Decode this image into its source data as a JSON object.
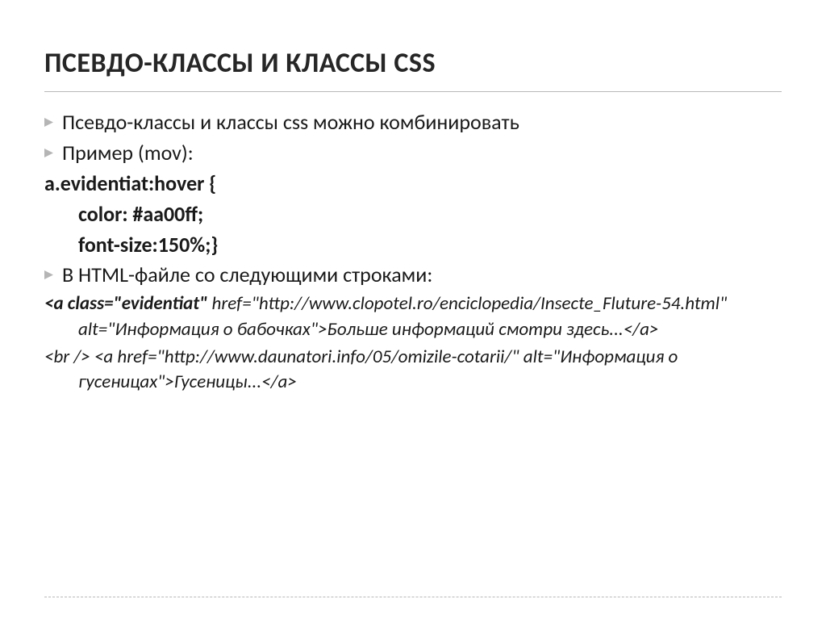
{
  "title": "ПСЕВДО-КЛАССЫ И КЛАССЫ CSS",
  "bullets": {
    "b1": "Псевдо-классы и классы css можно комбинировать",
    "b2": "Пример (mov):",
    "b3": "В HTML-файле со следующими строками:"
  },
  "code": {
    "line1": "a.evidentiat:hover {",
    "line2": "color: #aa00ff;",
    "line3": "font-size:150%;}"
  },
  "html_example": {
    "part1_bold": "<a class=\"evidentiat\"",
    "part2": "href=\"http://www.clopotel.ro/enciclopedia/Insecte_Fluture-54.html\" alt=\"Информация о бабочках\">Больше информаций смотри здесь...</a>",
    "part3": "<br />      <a href=\"http://www.daunatori.info/05/omizile-cotarii/\" alt=\"Информация о гусеницах\">Гусеницы...</a>"
  }
}
